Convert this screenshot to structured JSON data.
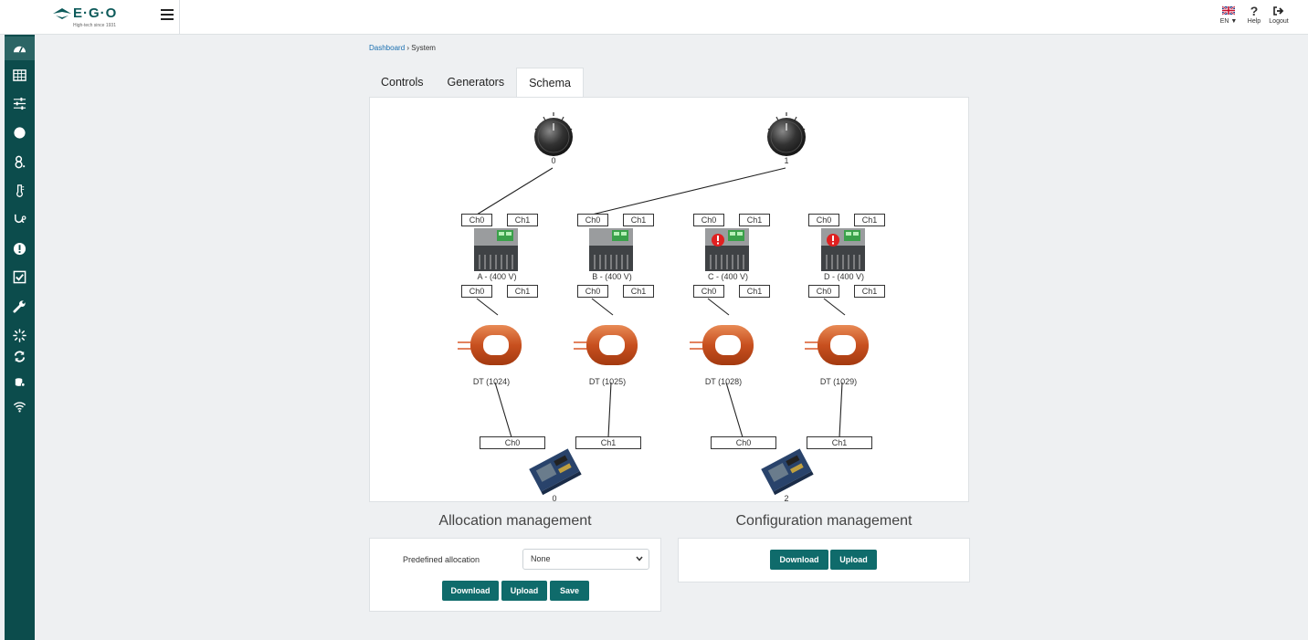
{
  "header": {
    "logo_text": "E·G·O",
    "logo_tagline": "High-tech since 1931",
    "lang": "EN",
    "help_label": "Help",
    "logout_label": "Logout"
  },
  "sidebar": {
    "items": [
      {
        "icon": "dashboard-icon",
        "active": true
      },
      {
        "icon": "table-icon"
      },
      {
        "icon": "sliders-icon"
      },
      {
        "icon": "circle-icon"
      },
      {
        "icon": "key-icon"
      },
      {
        "icon": "thermometer-icon"
      },
      {
        "icon": "stethoscope-icon"
      },
      {
        "icon": "alert-icon"
      },
      {
        "icon": "checkbox-icon"
      },
      {
        "icon": "wrench-icon"
      },
      {
        "icon": "spinner-icon"
      },
      {
        "icon": "sync-icon"
      },
      {
        "icon": "database-icon"
      },
      {
        "icon": "wifi-icon"
      }
    ]
  },
  "breadcrumb": {
    "root": "Dashboard",
    "sep": "›",
    "current": "System"
  },
  "tabs": [
    "Controls",
    "Generators",
    "Schema"
  ],
  "active_tab": "Schema",
  "schema": {
    "knobs": [
      "0",
      "1"
    ],
    "generators": [
      {
        "label": "A - (400 V)",
        "error": false
      },
      {
        "label": "B - (400 V)",
        "error": false
      },
      {
        "label": "C - (400 V)",
        "error": true
      },
      {
        "label": "D - (400 V)",
        "error": true
      }
    ],
    "channel_labels": [
      "Ch0",
      "Ch1"
    ],
    "coils": [
      "DT (1024)",
      "DT (1025)",
      "DT (1028)",
      "DT (1029)"
    ],
    "boards": [
      "0",
      "2"
    ],
    "board_channels": [
      "Ch0",
      "Ch1",
      "Ch0",
      "Ch1"
    ]
  },
  "allocation": {
    "title": "Allocation management",
    "predefined_label": "Predefined allocation",
    "selected": "None",
    "download": "Download",
    "upload": "Upload",
    "save": "Save"
  },
  "configuration": {
    "title": "Configuration management",
    "download": "Download",
    "upload": "Upload"
  },
  "colors": {
    "primary": "#0f6b6b",
    "sidebar": "#0c4c4c",
    "error": "#e02020",
    "coil": "#d8582a"
  }
}
